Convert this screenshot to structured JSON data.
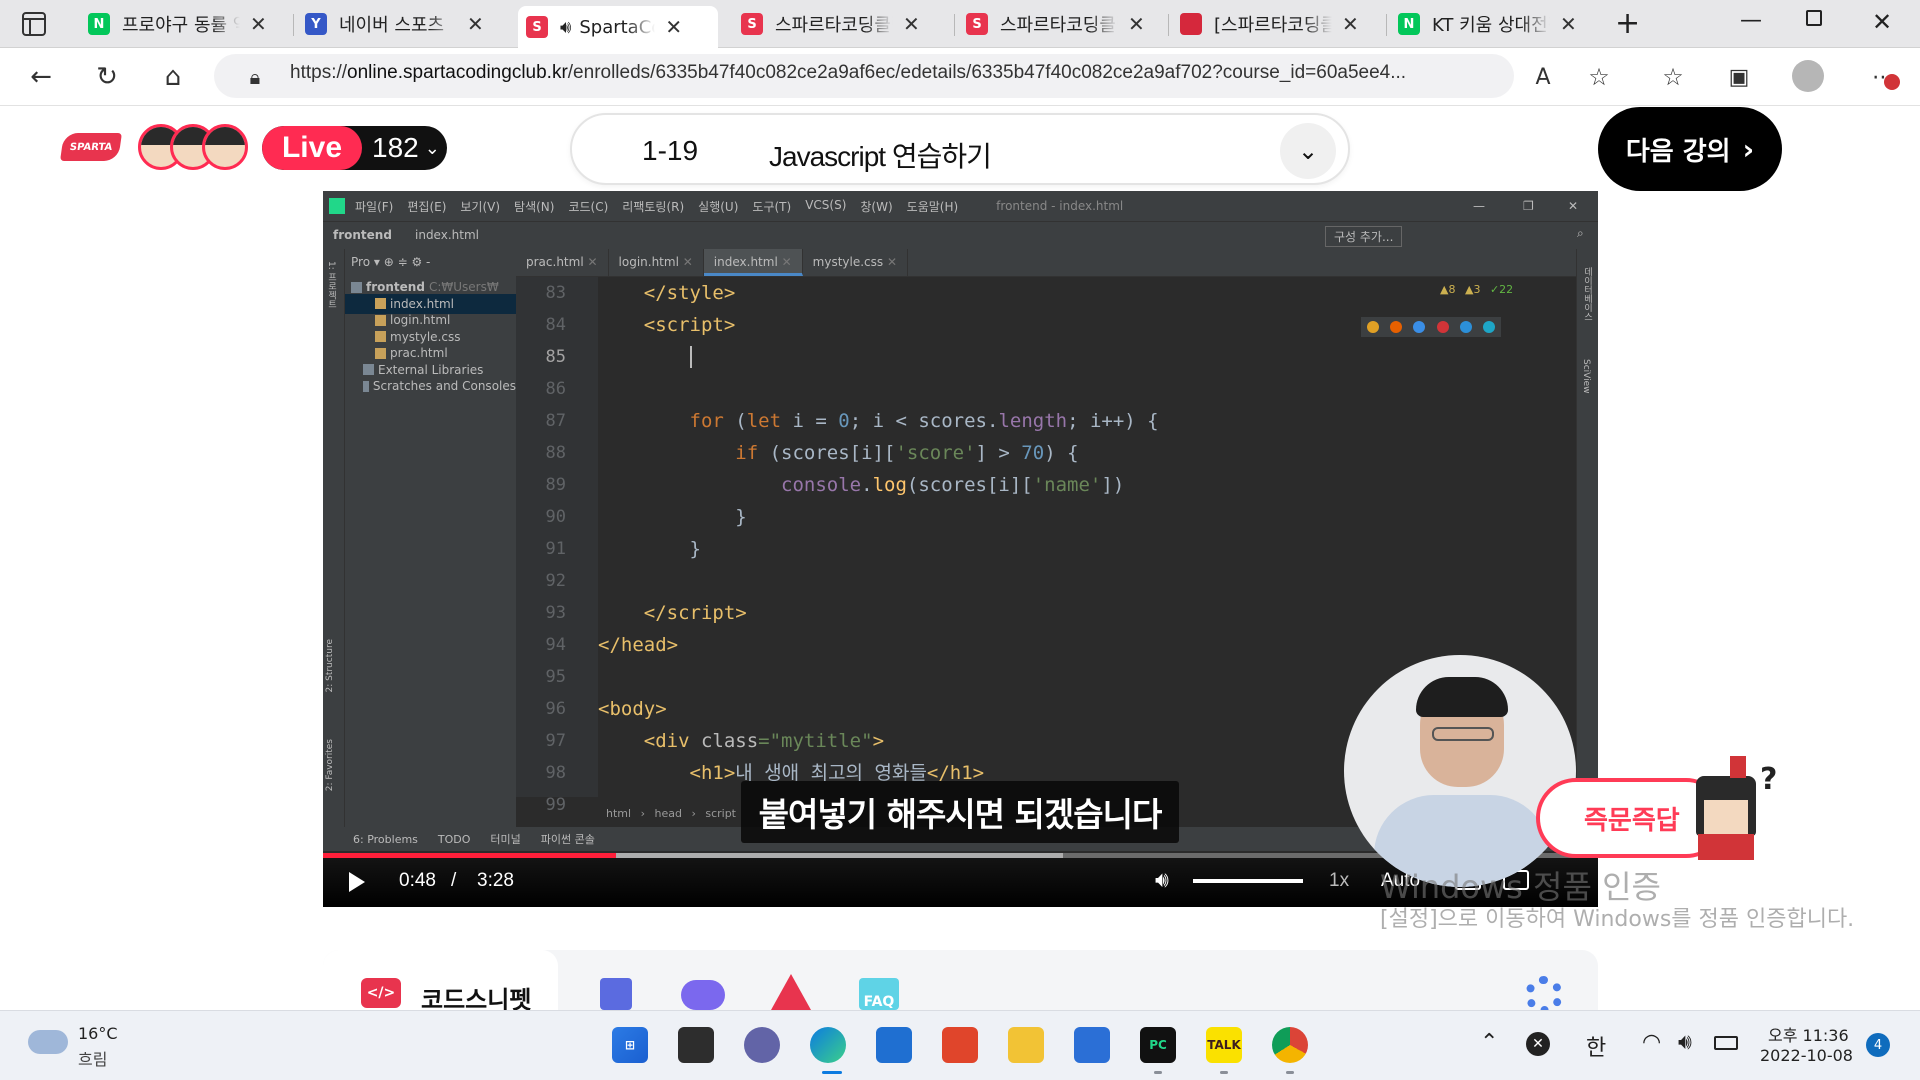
{
  "browser": {
    "tabs": [
      {
        "label": "프로야구 동률 역대 최초",
        "favicon_text": "N",
        "favicon_color": "#03c75a",
        "active": false
      },
      {
        "label": "네이버 스포츠",
        "favicon_text": "Y",
        "favicon_color": "#3558c7",
        "active": false
      },
      {
        "label": "SpartaCodingClub",
        "favicon_text": "S",
        "favicon_color": "#e8344e",
        "active": true
      },
      {
        "label": "스파르타코딩클럽",
        "favicon_text": "S",
        "favicon_color": "#e8344e",
        "active": false
      },
      {
        "label": "스파르타코딩클럽",
        "favicon_text": "S",
        "favicon_color": "#e8344e",
        "active": false
      },
      {
        "label": "[스파르타코딩클럽]",
        "favicon_text": "",
        "favicon_color": "#d5283c",
        "active": false
      },
      {
        "label": "KT 키움 상대전적",
        "favicon_text": "N",
        "favicon_color": "#03c75a",
        "active": false
      }
    ],
    "url_prefix": "https://",
    "url_host": "online.spartacodingclub.kr",
    "url_path": "/enrolleds/6335b47f40c082ce2a9af6ec/edetails/6335b47f40c082ce2a9af702?course_id=60a5ee4..."
  },
  "header": {
    "logo_text": "SPARTA",
    "live_label": "Live",
    "live_count": "182",
    "lesson_number": "1-19",
    "lesson_title": "Javascript 연습하기",
    "next_label": "다음 강의"
  },
  "ide": {
    "menu": [
      "파일(F)",
      "편집(E)",
      "보기(V)",
      "탐색(N)",
      "코드(C)",
      "리팩토링(R)",
      "실행(U)",
      "도구(T)",
      "VCS(S)",
      "창(W)",
      "도움말(H)"
    ],
    "window_title": "frontend - index.html",
    "breadcrumb_project": "frontend",
    "breadcrumb_file": "index.html",
    "run_config": "구성 추가...",
    "tabs": [
      "prac.html",
      "login.html",
      "index.html",
      "mystyle.css"
    ],
    "active_tab": "index.html",
    "project_label": "Pro",
    "project_tree": [
      {
        "label": "frontend",
        "extra": "C:₩Users₩",
        "indent": 0,
        "selected": false
      },
      {
        "label": "index.html",
        "extra": "",
        "indent": 2,
        "selected": true
      },
      {
        "label": "login.html",
        "extra": "",
        "indent": 2,
        "selected": false
      },
      {
        "label": "mystyle.css",
        "extra": "",
        "indent": 2,
        "selected": false
      },
      {
        "label": "prac.html",
        "extra": "",
        "indent": 2,
        "selected": false
      },
      {
        "label": "External Libraries",
        "extra": "",
        "indent": 1,
        "selected": false
      },
      {
        "label": "Scratches and Consoles",
        "extra": "",
        "indent": 1,
        "selected": false
      }
    ],
    "inspections": {
      "warnings": "8",
      "weak_warnings": "3",
      "typos": "22"
    },
    "line_numbers": [
      "83",
      "84",
      "85",
      "86",
      "87",
      "88",
      "89",
      "90",
      "91",
      "92",
      "93",
      "94",
      "95",
      "96",
      "97",
      "98",
      "99"
    ],
    "code_breadcrumb": [
      "html",
      "head",
      "script"
    ],
    "bottom_tools": [
      "6: Problems",
      "TODO",
      "터미널",
      "파이썬 콘솔"
    ],
    "left_tools": [
      "1: 프로젝트",
      "2: Structure",
      "2: Favorites"
    ],
    "right_tools": [
      "데이터베이스",
      "SciView"
    ]
  },
  "video": {
    "current_time": "0:48",
    "time_separator": "/",
    "duration": "3:28",
    "progress_fraction": 0.23,
    "buffered_fraction": 0.58,
    "volume_fraction": 1.0,
    "speed": "1x",
    "quality": "Auto",
    "subtitle": "붙여넣기 해주시면 되겠습니다",
    "qa_button": "즉문즉답"
  },
  "watermark": {
    "line1": "Windows 정품 인증",
    "line2": "[설정]으로 이동하여 Windows를 정품 인증합니다."
  },
  "panel": {
    "snippet_label": "코드스니펫",
    "faq_label": "FAQ"
  },
  "taskbar": {
    "weather_temp": "16°C",
    "weather_desc": "흐림",
    "ime": "한",
    "time": "오후 11:36",
    "date": "2022-10-08",
    "notifications": "4"
  },
  "colors": {
    "brand": "#e8344e",
    "live": "#ff2b52",
    "ide_bg": "#2b2b2b",
    "progress": "#ff1f3a"
  }
}
